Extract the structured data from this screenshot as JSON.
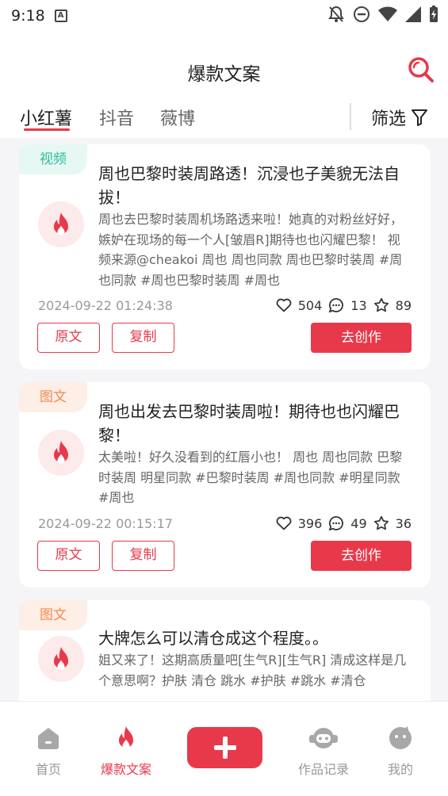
{
  "status_bar": {
    "time": "9:18"
  },
  "header": {
    "title": "爆款文案"
  },
  "tabs": [
    {
      "label": "小红薯"
    },
    {
      "label": "抖音"
    },
    {
      "label": "薇博"
    }
  ],
  "filter": {
    "label": "筛选"
  },
  "colors": {
    "accent": "#e8394b",
    "video_tag": "#2bbf98",
    "image_tag": "#f08a54"
  },
  "posts": [
    {
      "type": "视频",
      "title": "周也巴黎时装周路透！沉浸也子美貌无法自拔！",
      "desc": "周也去巴黎时装周机场路透来啦！她真的对粉丝好好，嫉妒在现场的每一个人[皱眉R]期待也也闪耀巴黎！ 视频来源@cheakoi 周也 周也同款 周也巴黎时装周 #周也同款 #周也巴黎时装周 #周也",
      "date": "2024-09-22 01:24:38",
      "likes": "504",
      "comments": "13",
      "favorites": "89"
    },
    {
      "type": "图文",
      "title": "周也出发去巴黎时装周啦！期待也也闪耀巴黎！",
      "desc": "太美啦！好久没看到的红唇小也！ 周也 周也同款 巴黎时装周 明星同款 #巴黎时装周 #周也同款 #明星同款 #周也",
      "date": "2024-09-22 00:15:17",
      "likes": "396",
      "comments": "49",
      "favorites": "36"
    },
    {
      "type": "图文",
      "title": "大牌怎么可以清仓成这个程度。。",
      "desc": "姐又来了！这期高质量吧[生气R][生气R] 清成这样是几个意思啊？护肤 清仓 跳水 #护肤 #跳水 #清仓"
    }
  ],
  "buttons": {
    "original": "原文",
    "copy": "复制",
    "create": "去创作"
  },
  "bottom_nav": [
    {
      "label": "首页"
    },
    {
      "label": "爆款文案"
    },
    {
      "label": "作品记录"
    },
    {
      "label": "我的"
    }
  ]
}
